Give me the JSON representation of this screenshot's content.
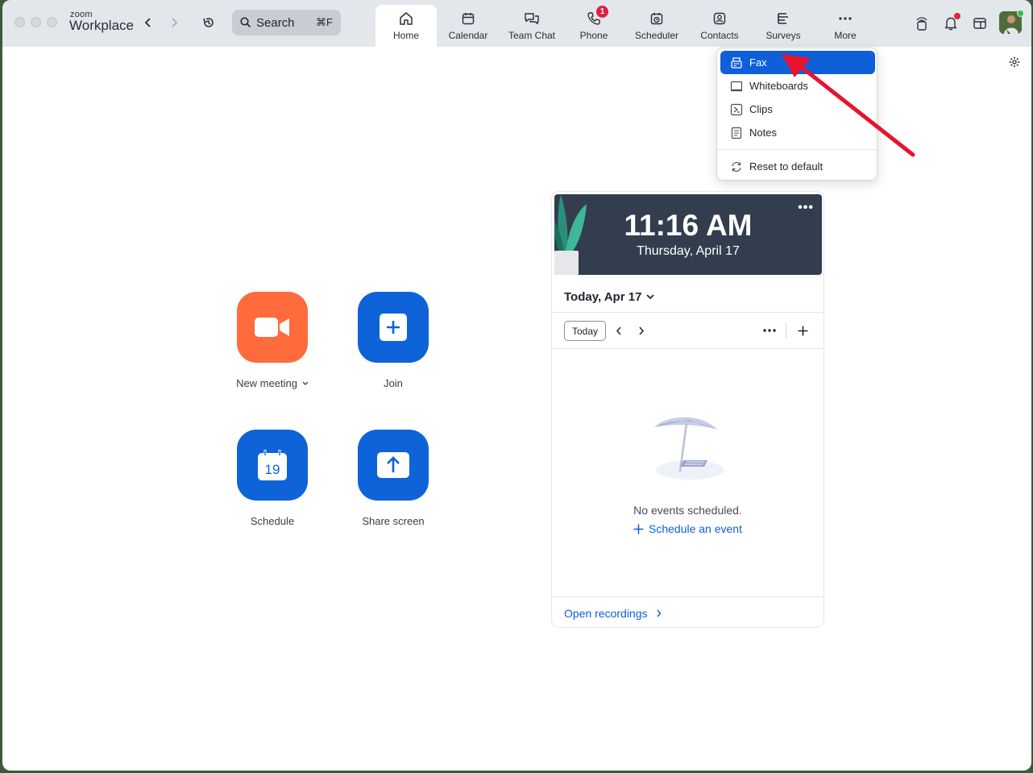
{
  "window": {
    "brand_small": "zoom",
    "brand_big": "Workplace"
  },
  "search": {
    "label": "Search",
    "shortcut": "⌘F"
  },
  "tabs": [
    {
      "id": "home",
      "label": "Home",
      "icon": "home-icon",
      "active": true
    },
    {
      "id": "calendar",
      "label": "Calendar",
      "icon": "calendar-icon"
    },
    {
      "id": "team-chat",
      "label": "Team Chat",
      "icon": "chat-icon"
    },
    {
      "id": "phone",
      "label": "Phone",
      "icon": "phone-icon",
      "badge": "1"
    },
    {
      "id": "scheduler",
      "label": "Scheduler",
      "icon": "scheduler-icon"
    },
    {
      "id": "contacts",
      "label": "Contacts",
      "icon": "contacts-icon"
    },
    {
      "id": "surveys",
      "label": "Surveys",
      "icon": "surveys-icon"
    },
    {
      "id": "more",
      "label": "More",
      "icon": "more-icon"
    }
  ],
  "actions": {
    "new_meeting": "New meeting",
    "join": "Join",
    "schedule": "Schedule",
    "schedule_day": "19",
    "share_screen": "Share screen"
  },
  "calendar_card": {
    "time": "11:16 AM",
    "date": "Thursday, April 17",
    "selected_day": "Today, Apr 17",
    "today_button": "Today",
    "empty_message": "No events scheduled.",
    "schedule_link": "Schedule an event",
    "recordings_link": "Open recordings"
  },
  "more_menu": {
    "items": [
      {
        "label": "Fax",
        "icon": "fax-icon",
        "selected": true
      },
      {
        "label": "Whiteboards",
        "icon": "whiteboard-icon"
      },
      {
        "label": "Clips",
        "icon": "clips-icon"
      },
      {
        "label": "Notes",
        "icon": "notes-icon"
      }
    ],
    "reset_label": "Reset to default"
  },
  "colors": {
    "accent_blue": "#0e5fd8",
    "new_meeting_orange": "#ff6b3d",
    "annotation_arrow": "#e8132d"
  }
}
